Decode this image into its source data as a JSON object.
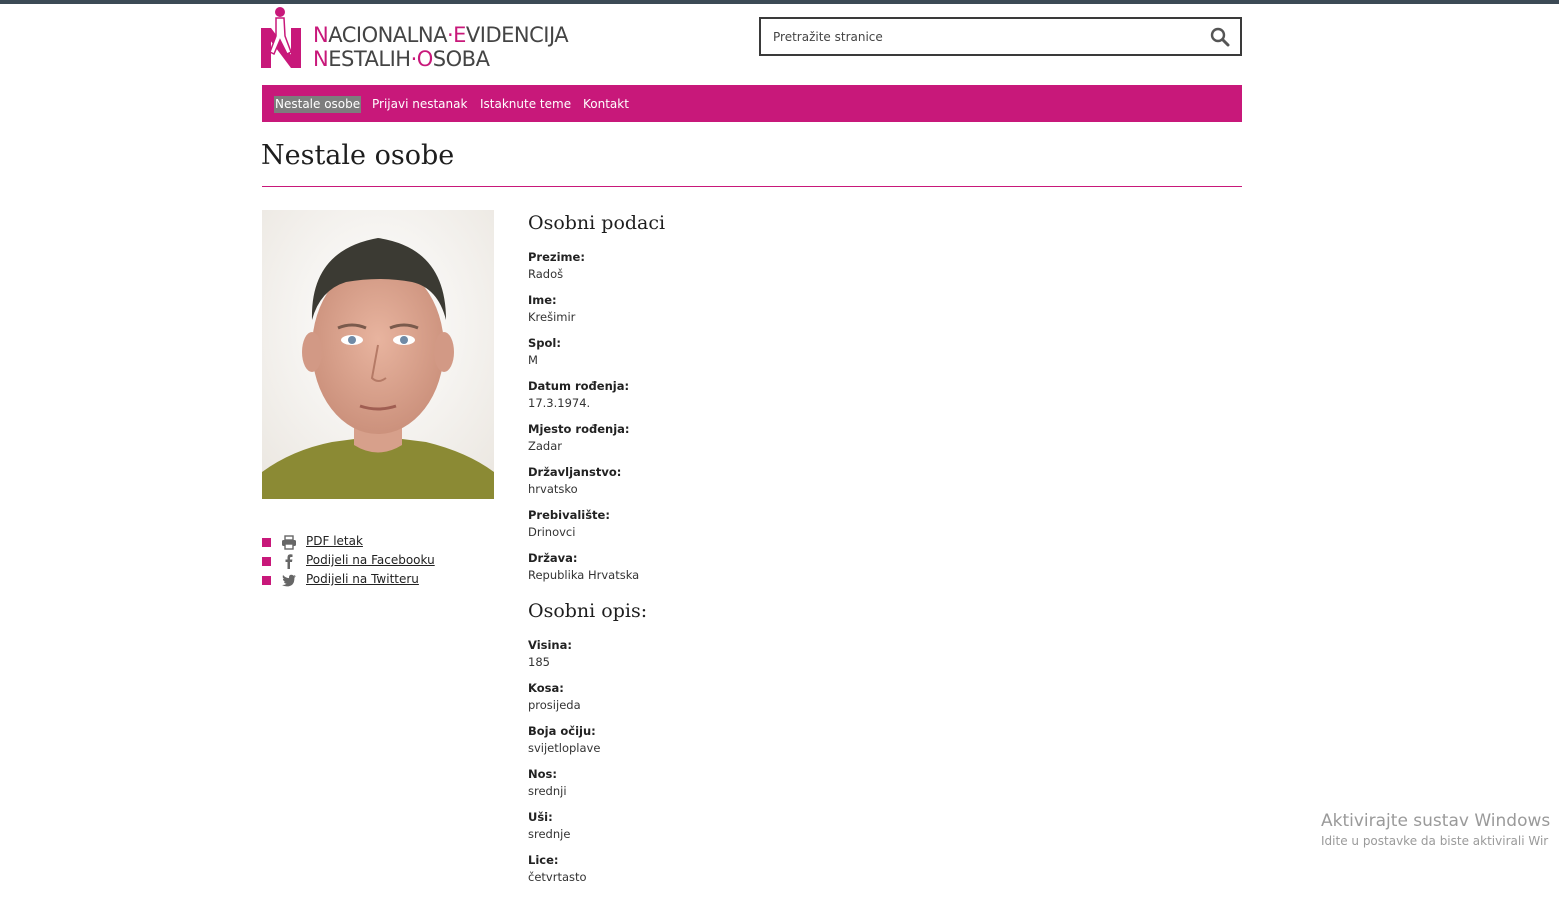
{
  "header": {
    "logo": {
      "line1": [
        {
          "cap": "N",
          "rest": "ACIONALNA"
        },
        {
          "cap": "·E",
          "rest": "VIDENCIJA"
        }
      ],
      "line2": [
        {
          "cap": "N",
          "rest": "ESTALIH"
        },
        {
          "cap": "·O",
          "rest": "SOBA"
        }
      ]
    },
    "search": {
      "placeholder": "Pretražite stranice",
      "value": "",
      "icon": "search-icon"
    }
  },
  "nav": {
    "items": [
      {
        "label": "Nestale osobe",
        "active": true
      },
      {
        "label": "Prijavi nestanak",
        "active": false
      },
      {
        "label": "Istaknute teme",
        "active": false
      },
      {
        "label": "Kontakt",
        "active": false
      }
    ]
  },
  "page": {
    "title": "Nestale osobe"
  },
  "photo": {
    "description": "portrait-photo"
  },
  "share": [
    {
      "icon": "print-icon",
      "label": "PDF letak"
    },
    {
      "icon": "facebook-icon",
      "label": "Podijeli na Facebooku"
    },
    {
      "icon": "twitter-icon",
      "label": "Podijeli na Twitteru"
    }
  ],
  "personal": {
    "heading": "Osobni podaci",
    "fields": [
      {
        "label": "Prezime:",
        "value": "Radoš"
      },
      {
        "label": "Ime:",
        "value": "Krešimir"
      },
      {
        "label": "Spol:",
        "value": "M"
      },
      {
        "label": "Datum rođenja:",
        "value": "17.3.1974."
      },
      {
        "label": "Mjesto rođenja:",
        "value": "Zadar"
      },
      {
        "label": "Državljanstvo:",
        "value": "hrvatsko"
      },
      {
        "label": "Prebivalište:",
        "value": "Drinovci"
      },
      {
        "label": "Država:",
        "value": "Republika Hrvatska"
      }
    ]
  },
  "description": {
    "heading": "Osobni opis:",
    "fields": [
      {
        "label": "Visina:",
        "value": "185"
      },
      {
        "label": "Kosa:",
        "value": "prosijeda"
      },
      {
        "label": "Boja očiju:",
        "value": "svijetloplave"
      },
      {
        "label": "Nos:",
        "value": "srednji"
      },
      {
        "label": "Uši:",
        "value": "srednje"
      },
      {
        "label": "Lice:",
        "value": "četvrtasto"
      }
    ]
  },
  "watermark": {
    "line1": "Aktivirajte sustav Windows",
    "line2": "Idite u postavke da biste aktivirali Wir"
  },
  "colors": {
    "accent": "#c8187a",
    "nav_active": "#7d7d7d",
    "topbar": "#3c4a55"
  }
}
